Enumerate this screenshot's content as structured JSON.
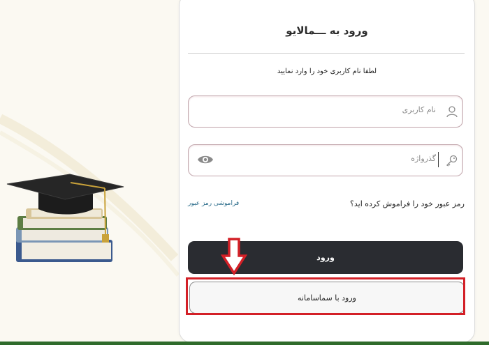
{
  "login": {
    "title": "ورود به ـــمالایو",
    "subtitle": "لطفا نام کاربری خود را وارد نمایید",
    "username_placeholder": "نام کاربری",
    "password_placeholder": "گذرواژه",
    "forgot_question": "رمز عبور خود را فراموش کرده اید؟",
    "forgot_link": "فراموشی رمز عبور",
    "login_button": "ورود",
    "sama_button": "ورود با سماسامانه"
  },
  "icons": {
    "user": "user-icon",
    "key": "key-icon",
    "eye": "eye-icon",
    "arrow": "arrow-down-icon",
    "illustration": "graduation-books-illustration"
  },
  "colors": {
    "primary_button": "#2a2c31",
    "highlight": "#d32027",
    "field_border": "#c2a7ad",
    "link": "#2d6e8c",
    "bottom_bar": "#2f6b2b"
  }
}
